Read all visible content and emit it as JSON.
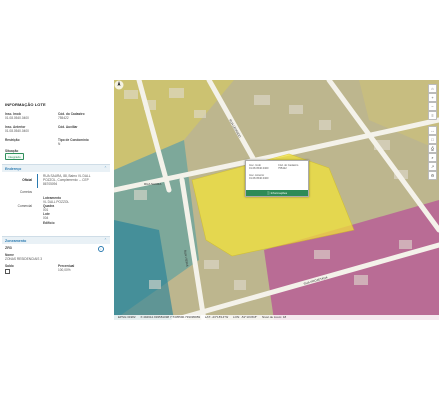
{
  "panel": {
    "title": "INFORMAÇÃO LOTE",
    "fields": [
      {
        "label": "Insc. Imob",
        "value": "01.08.0540.0400"
      },
      {
        "label": "Cód. do Cadastro",
        "value": "755422"
      },
      {
        "label": "Insc. Anterior",
        "value": "01.08.0540.0400"
      },
      {
        "label": "Cód. Auxiliar",
        "value": ""
      },
      {
        "label": "Restrição",
        "value": ""
      },
      {
        "label": "Tipo de Condomínio",
        "value": "N"
      }
    ],
    "situacao_label": "Situação",
    "situacao_value": "Integrado"
  },
  "endereco": {
    "title": "Endereço",
    "toggle": "⌃",
    "oficial_label": "Oficial",
    "oficial_value": "RUA SAURA, 88, Bairro VL DALL POZZOL, Complemento: -- CEP 86705094",
    "correios_label": "Correios",
    "loteamento_label": "Loteamento",
    "loteamento_value": "VL DALL POZZOL",
    "quadra_label": "Quadra",
    "quadra_value": "001",
    "lote_label": "Lote",
    "lote_value": "004",
    "comercial_label": "Comercial",
    "edificio_label": "Edifício"
  },
  "zoneamento": {
    "title": "Zoneamento",
    "toggle": "⌃",
    "code": "ZR3",
    "nome_label": "Nome",
    "nome_value": "ZONAS RESIDENCIAIS 3",
    "saldo_label": "Saldo",
    "percentual_label": "Percentual",
    "percentual_value": "100,00%"
  },
  "popup": {
    "insc_label": "Insc. Imob",
    "insc_value": "01.08.0540.0400",
    "cod_label": "Cód. do Cadastro",
    "cod_value": "755422",
    "ant_label": "Insc. Anterior",
    "ant_value": "01.08.0540.0400",
    "button": "Informações"
  },
  "status": {
    "epsg": "EPSG:31982",
    "xy": "X:494612.993581098 Y:7435590.739095959",
    "lat": "LAT: -23°18'14\"W",
    "lon": "LON: -51°10'28.8\"",
    "zoom": "Nível de zoom: 18"
  },
  "streets": [
    "RUA SAURA",
    "RUA LEONIDO",
    "RUA VIEIRA",
    "RUA PROJETADA"
  ],
  "colors": {
    "accent": "#2a7ab0",
    "parcel_highlight": "#f2e23a",
    "zone_magenta": "#c42d9e",
    "zone_teal": "#3a8fa0",
    "button_green": "#2e8b57"
  }
}
